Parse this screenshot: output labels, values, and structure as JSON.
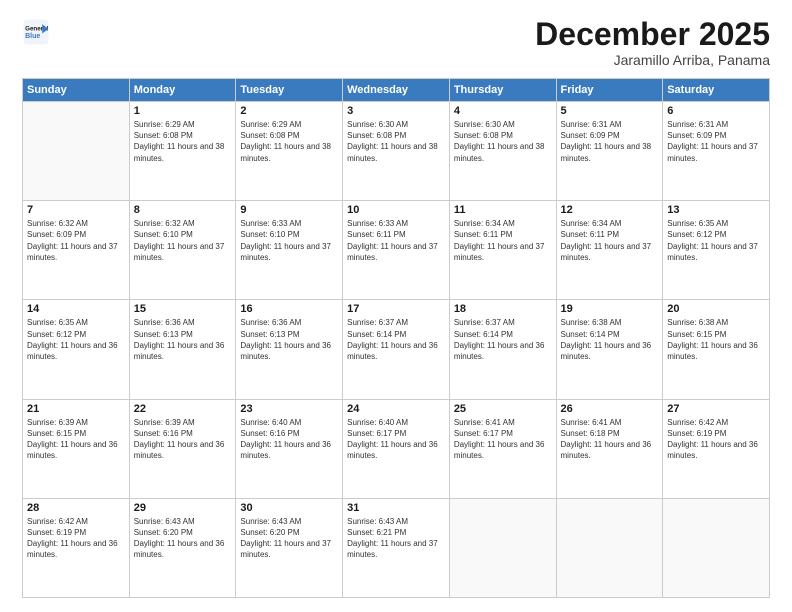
{
  "header": {
    "logo_line1": "General",
    "logo_line2": "Blue",
    "month": "December 2025",
    "location": "Jaramillo Arriba, Panama"
  },
  "weekdays": [
    "Sunday",
    "Monday",
    "Tuesday",
    "Wednesday",
    "Thursday",
    "Friday",
    "Saturday"
  ],
  "weeks": [
    [
      {
        "day": "",
        "empty": true
      },
      {
        "day": "1",
        "sunrise": "6:29 AM",
        "sunset": "6:08 PM",
        "daylight": "11 hours and 38 minutes."
      },
      {
        "day": "2",
        "sunrise": "6:29 AM",
        "sunset": "6:08 PM",
        "daylight": "11 hours and 38 minutes."
      },
      {
        "day": "3",
        "sunrise": "6:30 AM",
        "sunset": "6:08 PM",
        "daylight": "11 hours and 38 minutes."
      },
      {
        "day": "4",
        "sunrise": "6:30 AM",
        "sunset": "6:08 PM",
        "daylight": "11 hours and 38 minutes."
      },
      {
        "day": "5",
        "sunrise": "6:31 AM",
        "sunset": "6:09 PM",
        "daylight": "11 hours and 38 minutes."
      },
      {
        "day": "6",
        "sunrise": "6:31 AM",
        "sunset": "6:09 PM",
        "daylight": "11 hours and 37 minutes."
      }
    ],
    [
      {
        "day": "7",
        "sunrise": "6:32 AM",
        "sunset": "6:09 PM",
        "daylight": "11 hours and 37 minutes."
      },
      {
        "day": "8",
        "sunrise": "6:32 AM",
        "sunset": "6:10 PM",
        "daylight": "11 hours and 37 minutes."
      },
      {
        "day": "9",
        "sunrise": "6:33 AM",
        "sunset": "6:10 PM",
        "daylight": "11 hours and 37 minutes."
      },
      {
        "day": "10",
        "sunrise": "6:33 AM",
        "sunset": "6:11 PM",
        "daylight": "11 hours and 37 minutes."
      },
      {
        "day": "11",
        "sunrise": "6:34 AM",
        "sunset": "6:11 PM",
        "daylight": "11 hours and 37 minutes."
      },
      {
        "day": "12",
        "sunrise": "6:34 AM",
        "sunset": "6:11 PM",
        "daylight": "11 hours and 37 minutes."
      },
      {
        "day": "13",
        "sunrise": "6:35 AM",
        "sunset": "6:12 PM",
        "daylight": "11 hours and 37 minutes."
      }
    ],
    [
      {
        "day": "14",
        "sunrise": "6:35 AM",
        "sunset": "6:12 PM",
        "daylight": "11 hours and 36 minutes."
      },
      {
        "day": "15",
        "sunrise": "6:36 AM",
        "sunset": "6:13 PM",
        "daylight": "11 hours and 36 minutes."
      },
      {
        "day": "16",
        "sunrise": "6:36 AM",
        "sunset": "6:13 PM",
        "daylight": "11 hours and 36 minutes."
      },
      {
        "day": "17",
        "sunrise": "6:37 AM",
        "sunset": "6:14 PM",
        "daylight": "11 hours and 36 minutes."
      },
      {
        "day": "18",
        "sunrise": "6:37 AM",
        "sunset": "6:14 PM",
        "daylight": "11 hours and 36 minutes."
      },
      {
        "day": "19",
        "sunrise": "6:38 AM",
        "sunset": "6:14 PM",
        "daylight": "11 hours and 36 minutes."
      },
      {
        "day": "20",
        "sunrise": "6:38 AM",
        "sunset": "6:15 PM",
        "daylight": "11 hours and 36 minutes."
      }
    ],
    [
      {
        "day": "21",
        "sunrise": "6:39 AM",
        "sunset": "6:15 PM",
        "daylight": "11 hours and 36 minutes."
      },
      {
        "day": "22",
        "sunrise": "6:39 AM",
        "sunset": "6:16 PM",
        "daylight": "11 hours and 36 minutes."
      },
      {
        "day": "23",
        "sunrise": "6:40 AM",
        "sunset": "6:16 PM",
        "daylight": "11 hours and 36 minutes."
      },
      {
        "day": "24",
        "sunrise": "6:40 AM",
        "sunset": "6:17 PM",
        "daylight": "11 hours and 36 minutes."
      },
      {
        "day": "25",
        "sunrise": "6:41 AM",
        "sunset": "6:17 PM",
        "daylight": "11 hours and 36 minutes."
      },
      {
        "day": "26",
        "sunrise": "6:41 AM",
        "sunset": "6:18 PM",
        "daylight": "11 hours and 36 minutes."
      },
      {
        "day": "27",
        "sunrise": "6:42 AM",
        "sunset": "6:19 PM",
        "daylight": "11 hours and 36 minutes."
      }
    ],
    [
      {
        "day": "28",
        "sunrise": "6:42 AM",
        "sunset": "6:19 PM",
        "daylight": "11 hours and 36 minutes."
      },
      {
        "day": "29",
        "sunrise": "6:43 AM",
        "sunset": "6:20 PM",
        "daylight": "11 hours and 36 minutes."
      },
      {
        "day": "30",
        "sunrise": "6:43 AM",
        "sunset": "6:20 PM",
        "daylight": "11 hours and 37 minutes."
      },
      {
        "day": "31",
        "sunrise": "6:43 AM",
        "sunset": "6:21 PM",
        "daylight": "11 hours and 37 minutes."
      },
      {
        "day": "",
        "empty": true
      },
      {
        "day": "",
        "empty": true
      },
      {
        "day": "",
        "empty": true
      }
    ]
  ]
}
